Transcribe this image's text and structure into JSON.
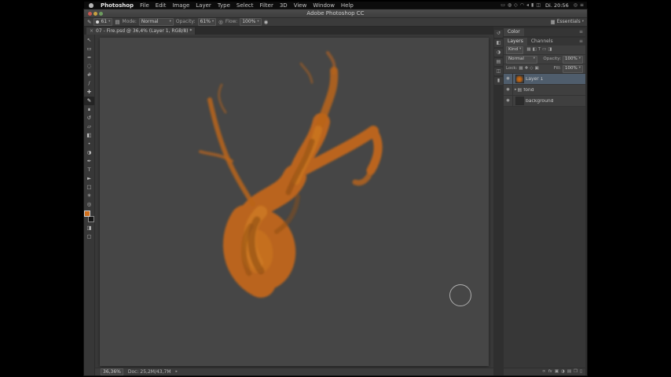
{
  "menubar": {
    "items": [
      "Photoshop",
      "File",
      "Edit",
      "Image",
      "Layer",
      "Type",
      "Select",
      "Filter",
      "3D",
      "View",
      "Window",
      "Help"
    ],
    "status_icons": [
      {
        "name": "display-menu-icon",
        "glyph": "▭"
      },
      {
        "name": "sync-menu-icon",
        "glyph": "◍"
      },
      {
        "name": "bluetooth-menu-icon",
        "glyph": "◇"
      },
      {
        "name": "wifi-menu-icon",
        "glyph": "◠"
      },
      {
        "name": "volume-menu-icon",
        "glyph": "◂"
      },
      {
        "name": "battery-menu-icon",
        "glyph": "▮"
      },
      {
        "name": "input-menu-icon",
        "glyph": "◫"
      }
    ],
    "clock": "Di. 20:56",
    "right_icons": [
      {
        "name": "spotlight-icon",
        "glyph": "◎"
      },
      {
        "name": "notification-center-icon",
        "glyph": "≡"
      }
    ]
  },
  "window": {
    "title": "Adobe Photoshop CC"
  },
  "options": {
    "tool_glyph": "✎",
    "brush_size": "61",
    "panel_toggle_glyph": "▤",
    "mode_label": "Mode:",
    "mode_value": "Normal",
    "opacity_label": "Opacity:",
    "opacity_value": "61%",
    "pressure_glyph": "◎",
    "flow_label": "Flow:",
    "flow_value": "100%",
    "airbrush_glyph": "◉",
    "workspace_glyph": "▦",
    "workspace": "Essentials"
  },
  "tab": {
    "close": "×",
    "title": "07 - Fire.psd @ 36,4% (Layer 1, RGB/8) *"
  },
  "tools": [
    {
      "name": "move-tool",
      "glyph": "↖"
    },
    {
      "name": "rectangular-marquee-tool",
      "glyph": "▭"
    },
    {
      "name": "lasso-tool",
      "glyph": "≈"
    },
    {
      "name": "quick-selection-tool",
      "glyph": "◌"
    },
    {
      "name": "crop-tool",
      "glyph": "#"
    },
    {
      "name": "eyedropper-tool",
      "glyph": "∕"
    },
    {
      "name": "spot-healing-brush-tool",
      "glyph": "✚"
    },
    {
      "name": "brush-tool",
      "glyph": "✎",
      "selected": true
    },
    {
      "name": "clone-stamp-tool",
      "glyph": "∎"
    },
    {
      "name": "history-brush-tool",
      "glyph": "↺"
    },
    {
      "name": "eraser-tool",
      "glyph": "▱"
    },
    {
      "name": "gradient-tool",
      "glyph": "◧"
    },
    {
      "name": "blur-tool",
      "glyph": "•"
    },
    {
      "name": "dodge-tool",
      "glyph": "◑"
    },
    {
      "name": "pen-tool",
      "glyph": "✒"
    },
    {
      "name": "type-tool",
      "glyph": "T"
    },
    {
      "name": "path-selection-tool",
      "glyph": "►"
    },
    {
      "name": "rectangle-tool",
      "glyph": "□"
    },
    {
      "name": "hand-tool",
      "glyph": "✳"
    },
    {
      "name": "zoom-tool",
      "glyph": "◎"
    }
  ],
  "tools_bottom": [
    {
      "name": "quick-mask-button",
      "glyph": "◨"
    },
    {
      "name": "screen-mode-button",
      "glyph": "▢"
    }
  ],
  "swatches": {
    "foreground": "#d06f1c",
    "background": "#161616"
  },
  "dock_icons": [
    {
      "name": "history-panel-icon",
      "glyph": "↺"
    },
    {
      "name": "properties-panel-icon",
      "glyph": "◧"
    },
    {
      "name": "adjustments-panel-icon",
      "glyph": "◑"
    },
    {
      "name": "styles-panel-icon",
      "glyph": "▤"
    },
    {
      "name": "info-panel-icon",
      "glyph": "◫"
    },
    {
      "name": "actions-panel-icon",
      "glyph": "▮"
    }
  ],
  "color_panel": {
    "tab": "Color"
  },
  "layers_panel": {
    "tabs": [
      {
        "label": "Layers",
        "active": true
      },
      {
        "label": "Channels",
        "active": false
      }
    ],
    "filter_label": "Kind",
    "filter_icons": [
      {
        "name": "filter-pixel-layers-icon",
        "glyph": "▦"
      },
      {
        "name": "filter-adjustment-layers-icon",
        "glyph": "◧"
      },
      {
        "name": "filter-type-layers-icon",
        "glyph": "T"
      },
      {
        "name": "filter-shape-layers-icon",
        "glyph": "▭"
      },
      {
        "name": "filter-smart-objects-icon",
        "glyph": "◨"
      }
    ],
    "blend_mode": "Normal",
    "opacity_label": "Opacity:",
    "opacity_value": "100%",
    "lock_label": "Lock:",
    "lock_icons": [
      {
        "name": "lock-transparency-icon",
        "glyph": "▦"
      },
      {
        "name": "lock-pixels-icon",
        "glyph": "✚"
      },
      {
        "name": "lock-position-icon",
        "glyph": "◇"
      },
      {
        "name": "lock-all-icon",
        "glyph": "▣"
      }
    ],
    "fill_label": "Fill:",
    "fill_value": "100%",
    "layers": [
      {
        "name": "Layer 1",
        "kind": "image",
        "selected": true,
        "eye": true
      },
      {
        "name": "fond",
        "kind": "group",
        "selected": false,
        "eye": true
      },
      {
        "name": "background",
        "kind": "image-dark",
        "selected": false,
        "eye": true
      }
    ],
    "footer_icons": [
      {
        "name": "link-layers-icon",
        "glyph": "∞"
      },
      {
        "name": "layer-style-icon",
        "glyph": "fx"
      },
      {
        "name": "add-layer-mask-icon",
        "glyph": "▣"
      },
      {
        "name": "new-adjustment-layer-icon",
        "glyph": "◑"
      },
      {
        "name": "new-group-icon",
        "glyph": "▤"
      },
      {
        "name": "new-layer-icon",
        "glyph": "❐"
      },
      {
        "name": "delete-layer-icon",
        "glyph": "▯"
      }
    ]
  },
  "status": {
    "zoom": "36,36%",
    "doc": "Doc: 25,2M/43,7M",
    "arrow": "▸"
  },
  "canvas": {
    "flame_main": "#c1661a",
    "flame_light": "#d98123",
    "flame_dark": "#8f4d11"
  },
  "ui": {
    "caret": "▾",
    "eye": "◉",
    "folder": "▤",
    "disclosure": "▸",
    "menu": "≡"
  }
}
